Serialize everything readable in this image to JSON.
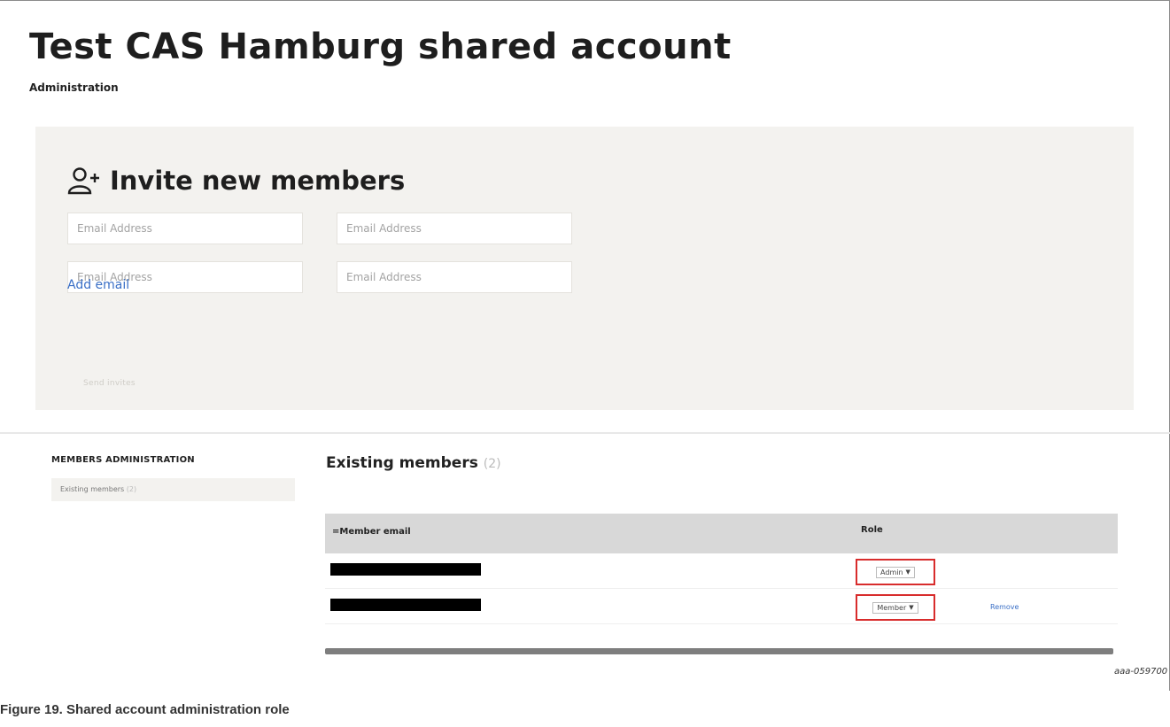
{
  "page": {
    "title": "Test CAS Hamburg shared account",
    "subtitle": "Administration"
  },
  "invite": {
    "title": "Invite new members",
    "icon": "add-user-icon",
    "email_placeholder": "Email Address",
    "add_email_label": "Add email",
    "send_invites_label": "Send invites"
  },
  "sidebar": {
    "heading": "MEMBERS ADMINISTRATION",
    "item_label": "Existing members",
    "item_count": "(2)"
  },
  "members": {
    "title": "Existing members",
    "count": "(2)",
    "columns": {
      "email": "=Member email",
      "role": "Role"
    },
    "rows": [
      {
        "role": "Admin",
        "remove_label": ""
      },
      {
        "role": "Member",
        "remove_label": "Remove"
      }
    ]
  },
  "figure": {
    "id": "aaa-059700",
    "caption": "Figure 19.  Shared account administration role"
  },
  "colors": {
    "panel_bg": "#f3f2ef",
    "link": "#3a6fc6",
    "highlight": "#d82c2c",
    "table_head": "#d8d8d8"
  }
}
